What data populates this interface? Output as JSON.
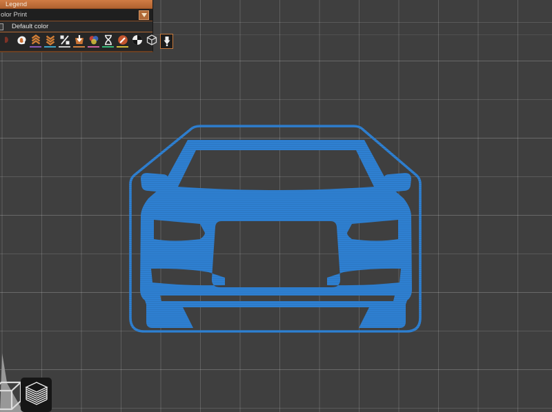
{
  "legend_panel": {
    "title": "Legend",
    "view_selector": {
      "value": "olor Print"
    },
    "items": [
      {
        "label": "Default color"
      }
    ],
    "view_icons": [
      {
        "name": "toolpath-partial-icon",
        "underline": null
      },
      {
        "name": "feature-type-icon",
        "underline": null
      },
      {
        "name": "layer-height-icon",
        "underline": "#8a5ab8"
      },
      {
        "name": "line-width-icon",
        "underline": "#3ea4c8"
      },
      {
        "name": "speed-icon",
        "underline": "#cccccc"
      },
      {
        "name": "fan-speed-icon",
        "underline": "#d08040"
      },
      {
        "name": "temperature-icon",
        "underline": "#cf5fa0"
      },
      {
        "name": "time-icon",
        "underline": "#35b877"
      },
      {
        "name": "tool-icon",
        "underline": "#d6bd3a"
      },
      {
        "name": "volumetric-flow-icon",
        "underline": null
      },
      {
        "name": "travel-moves-icon",
        "underline": null
      },
      {
        "name": "pin-legend-icon",
        "underline": null,
        "selected": true
      }
    ]
  },
  "viewport": {
    "model": {
      "name": "car-front-keychain"
    },
    "view_toggles": [
      {
        "name": "editor-3d-view",
        "active": false
      },
      {
        "name": "layers-preview-view",
        "active": true
      }
    ]
  },
  "colors": {
    "accent": "#c4713a",
    "model": "#2e80d2",
    "viewport-bg": "#3f3f3f",
    "panel-bg": "#262626"
  }
}
